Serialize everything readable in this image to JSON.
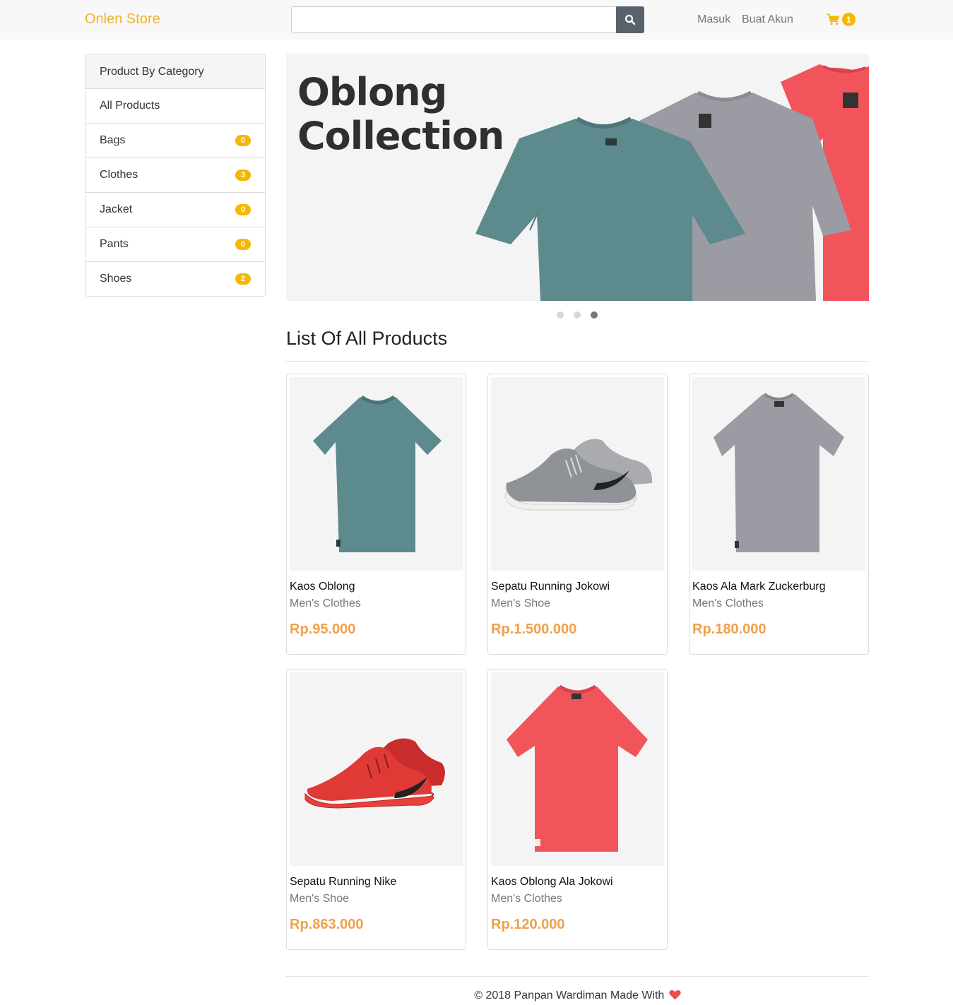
{
  "navbar": {
    "brand": "Onlen Store",
    "search_placeholder": "",
    "search_value": "",
    "login_label": "Masuk",
    "register_label": "Buat Akun",
    "cart_count": "1"
  },
  "sidebar": {
    "title": "Product By Category",
    "items": [
      {
        "label": "All Products",
        "count": null
      },
      {
        "label": "Bags",
        "count": "0"
      },
      {
        "label": "Clothes",
        "count": "3"
      },
      {
        "label": "Jacket",
        "count": "0"
      },
      {
        "label": "Pants",
        "count": "0"
      },
      {
        "label": "Shoes",
        "count": "2"
      }
    ]
  },
  "carousel": {
    "line1": "Oblong",
    "line2": "Collection",
    "slide_count": 3,
    "active_slide": 3,
    "shirt_colors": [
      "#5d8a8d",
      "#9b9ca3",
      "#f2545b"
    ]
  },
  "main": {
    "title": "List Of All Products",
    "products": [
      {
        "name": "Kaos Oblong",
        "category": "Men's Clothes",
        "price": "Rp.95.000",
        "image": "teal-tshirt"
      },
      {
        "name": "Sepatu Running Jokowi",
        "category": "Men's Shoe",
        "price": "Rp.1.500.000",
        "image": "grey-running-shoes"
      },
      {
        "name": "Kaos Ala Mark Zuckerburg",
        "category": "Men's Clothes",
        "price": "Rp.180.000",
        "image": "grey-tshirt"
      },
      {
        "name": "Sepatu Running Nike",
        "category": "Men's Shoe",
        "price": "Rp.863.000",
        "image": "red-running-shoes"
      },
      {
        "name": "Kaos Oblong Ala Jokowi",
        "category": "Men's Clothes",
        "price": "Rp.120.000",
        "image": "red-tshirt"
      }
    ]
  },
  "footer": {
    "text": "© 2018 Panpan Wardiman Made With"
  },
  "colors": {
    "brand": "#f0b429",
    "badge": "#f5b800",
    "price": "#f0a04b",
    "search_button": "#59626c"
  }
}
